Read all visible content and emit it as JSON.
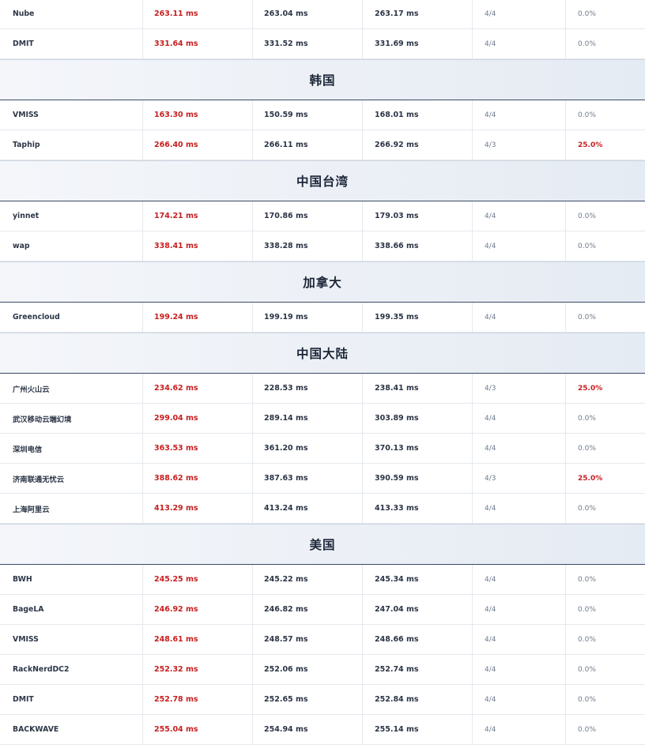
{
  "sections": [
    {
      "title": "",
      "rows": [
        {
          "node": "Nube",
          "v1": "263.11 ms",
          "v2": "263.04 ms",
          "v3": "263.17 ms",
          "count": "4/4",
          "loss": "0.0%"
        },
        {
          "node": "DMIT",
          "v1": "331.64 ms",
          "v2": "331.52 ms",
          "v3": "331.69 ms",
          "count": "4/4",
          "loss": "0.0%"
        }
      ]
    },
    {
      "title": "韩国",
      "rows": [
        {
          "node": "VMISS",
          "v1": "163.30 ms",
          "v2": "150.59 ms",
          "v3": "168.01 ms",
          "count": "4/4",
          "loss": "0.0%"
        },
        {
          "node": "Taphip",
          "v1": "266.40 ms",
          "v2": "266.11 ms",
          "v3": "266.92 ms",
          "count": "4/3",
          "loss": "25.0%"
        }
      ]
    },
    {
      "title": "中国台湾",
      "rows": [
        {
          "node": "yinnet",
          "v1": "174.21 ms",
          "v2": "170.86 ms",
          "v3": "179.03 ms",
          "count": "4/4",
          "loss": "0.0%"
        },
        {
          "node": "wap",
          "v1": "338.41 ms",
          "v2": "338.28 ms",
          "v3": "338.66 ms",
          "count": "4/4",
          "loss": "0.0%"
        }
      ]
    },
    {
      "title": "加拿大",
      "rows": [
        {
          "node": "Greencloud",
          "v1": "199.24 ms",
          "v2": "199.19 ms",
          "v3": "199.35 ms",
          "count": "4/4",
          "loss": "0.0%"
        }
      ]
    },
    {
      "title": "中国大陆",
      "rows": [
        {
          "node": "广州火山云",
          "v1": "234.62 ms",
          "v2": "228.53 ms",
          "v3": "238.41 ms",
          "count": "4/3",
          "loss": "25.0%"
        },
        {
          "node": "武汉移动云端幻境",
          "v1": "299.04 ms",
          "v2": "289.14 ms",
          "v3": "303.89 ms",
          "count": "4/4",
          "loss": "0.0%"
        },
        {
          "node": "深圳电信",
          "v1": "363.53 ms",
          "v2": "361.20 ms",
          "v3": "370.13 ms",
          "count": "4/4",
          "loss": "0.0%"
        },
        {
          "node": "济南联通无忧云",
          "v1": "388.62 ms",
          "v2": "387.63 ms",
          "v3": "390.59 ms",
          "count": "4/3",
          "loss": "25.0%"
        },
        {
          "node": "上海阿里云",
          "v1": "413.29 ms",
          "v2": "413.24 ms",
          "v3": "413.33 ms",
          "count": "4/4",
          "loss": "0.0%"
        }
      ]
    },
    {
      "title": "美国",
      "rows": [
        {
          "node": "BWH",
          "v1": "245.25 ms",
          "v2": "245.22 ms",
          "v3": "245.34 ms",
          "count": "4/4",
          "loss": "0.0%"
        },
        {
          "node": "BageLA",
          "v1": "246.92 ms",
          "v2": "246.82 ms",
          "v3": "247.04 ms",
          "count": "4/4",
          "loss": "0.0%"
        },
        {
          "node": "VMISS",
          "v1": "248.61 ms",
          "v2": "248.57 ms",
          "v3": "248.66 ms",
          "count": "4/4",
          "loss": "0.0%"
        },
        {
          "node": "RackNerdDC2",
          "v1": "252.32 ms",
          "v2": "252.06 ms",
          "v3": "252.74 ms",
          "count": "4/4",
          "loss": "0.0%"
        },
        {
          "node": "DMIT",
          "v1": "252.78 ms",
          "v2": "252.65 ms",
          "v3": "252.84 ms",
          "count": "4/4",
          "loss": "0.0%"
        },
        {
          "node": "BACKWAVE",
          "v1": "255.04 ms",
          "v2": "254.94 ms",
          "v3": "255.14 ms",
          "count": "4/4",
          "loss": "0.0%"
        }
      ]
    }
  ],
  "colors": {
    "accent_red": "#c81e1e",
    "text_dark": "#2b3445",
    "header_text": "#1d2638"
  }
}
